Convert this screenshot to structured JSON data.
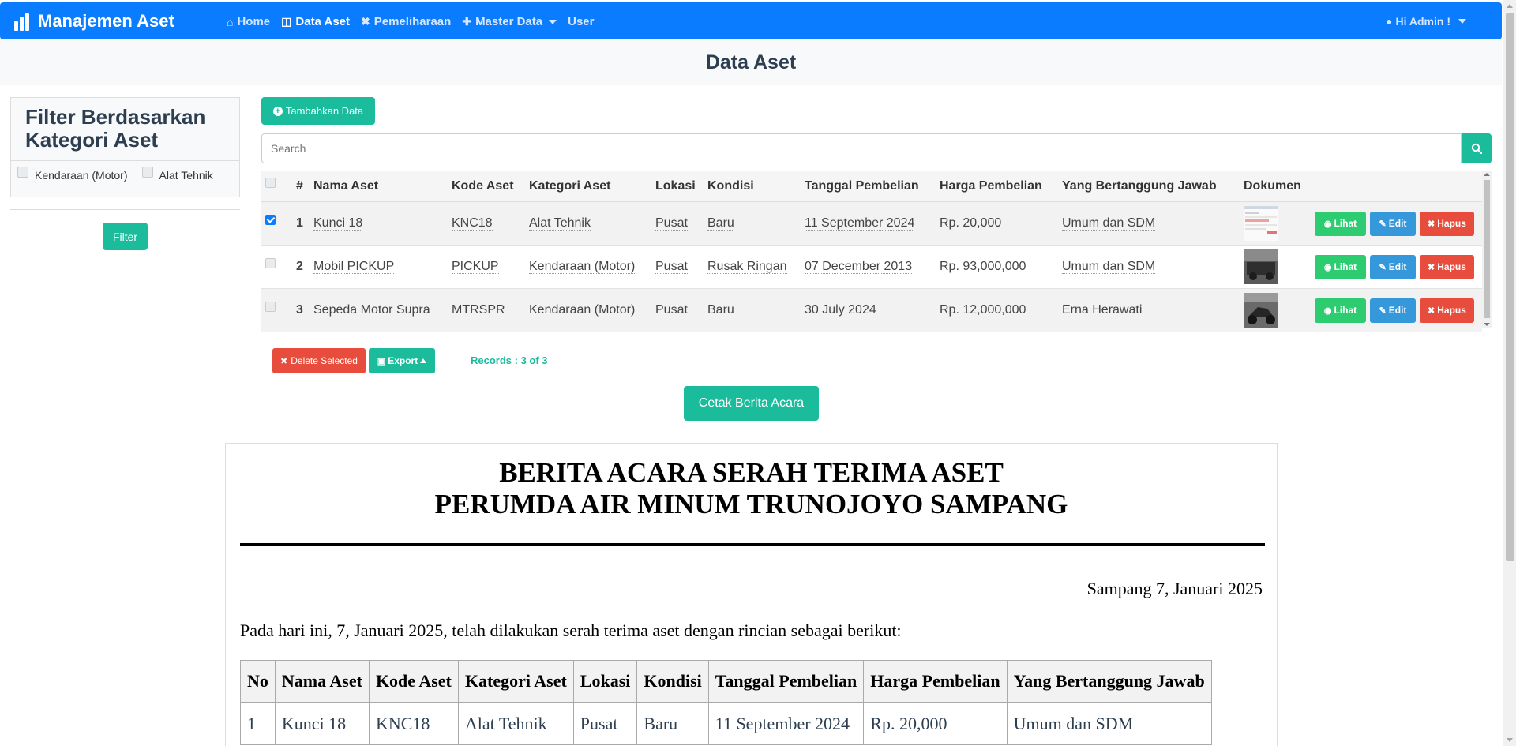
{
  "navbar": {
    "brand": "Manajemen Aset",
    "links": [
      {
        "label": "Home",
        "icon": "home-icon"
      },
      {
        "label": "Data Aset",
        "icon": "cube-icon"
      },
      {
        "label": "Pemeliharaan",
        "icon": "tools-icon"
      },
      {
        "label": "Master Data",
        "icon": "puzzle-icon"
      },
      {
        "label": "User",
        "icon": ""
      }
    ],
    "user": "Hi Admin !"
  },
  "page_title": "Data Aset",
  "filter": {
    "title": "Filter Berdasarkan Kategori Aset",
    "options": [
      "Kendaraan (Motor)",
      "Alat Tehnik"
    ],
    "button": "Filter"
  },
  "toolbar": {
    "add_label": "Tambahkan Data",
    "search_placeholder": "Search"
  },
  "table": {
    "headers": [
      "#",
      "Nama Aset",
      "Kode Aset",
      "Kategori Aset",
      "Lokasi",
      "Kondisi",
      "Tanggal Pembelian",
      "Harga Pembelian",
      "Yang Bertanggung Jawab",
      "Dokumen"
    ],
    "rows": [
      {
        "no": "1",
        "nama": "Kunci 18",
        "kode": "KNC18",
        "kategori": "Alat Tehnik",
        "lokasi": "Pusat",
        "kondisi": "Baru",
        "tanggal": "11 September 2024",
        "harga": "Rp. 20,000",
        "pj": "Umum dan SDM",
        "checked": true
      },
      {
        "no": "2",
        "nama": "Mobil PICKUP",
        "kode": "PICKUP",
        "kategori": "Kendaraan (Motor)",
        "lokasi": "Pusat",
        "kondisi": "Rusak Ringan",
        "tanggal": "07 December 2013",
        "harga": "Rp. 93,000,000",
        "pj": "Umum dan SDM",
        "checked": false
      },
      {
        "no": "3",
        "nama": "Sepeda Motor Supra",
        "kode": "MTRSPR",
        "kategori": "Kendaraan (Motor)",
        "lokasi": "Pusat",
        "kondisi": "Baru",
        "tanggal": "30 July 2024",
        "harga": "Rp. 12,000,000",
        "pj": "Erna Herawati",
        "checked": false
      }
    ],
    "actions": {
      "view": "Lihat",
      "edit": "Edit",
      "delete": "Hapus"
    }
  },
  "footer": {
    "delete_selected": "Delete Selected",
    "export": "Export",
    "records": "Records : 3 of 3",
    "cetak": "Cetak Berita Acara"
  },
  "document": {
    "title_line1": "BERITA ACARA SERAH TERIMA ASET",
    "title_line2": "PERUMDA AIR MINUM TRUNOJOYO SAMPANG",
    "date": "Sampang  7, Januari 2025",
    "intro": "Pada hari ini, 7, Januari 2025, telah dilakukan serah terima aset dengan rincian sebagai berikut:",
    "headers": [
      "No",
      "Nama Aset",
      "Kode Aset",
      "Kategori Aset",
      "Lokasi",
      "Kondisi",
      "Tanggal Pembelian",
      "Harga Pembelian",
      "Yang Bertanggung Jawab"
    ],
    "rows": [
      [
        "1",
        "Kunci 18",
        "KNC18",
        "Alat Tehnik",
        "Pusat",
        "Baru",
        "11 September 2024",
        "Rp. 20,000",
        "Umum dan SDM"
      ]
    ]
  },
  "colors": {
    "navbar": "#0a7cff",
    "accent": "#1abc9c",
    "view": "#2ecc71",
    "edit": "#3498db",
    "delete": "#e74c3c"
  }
}
